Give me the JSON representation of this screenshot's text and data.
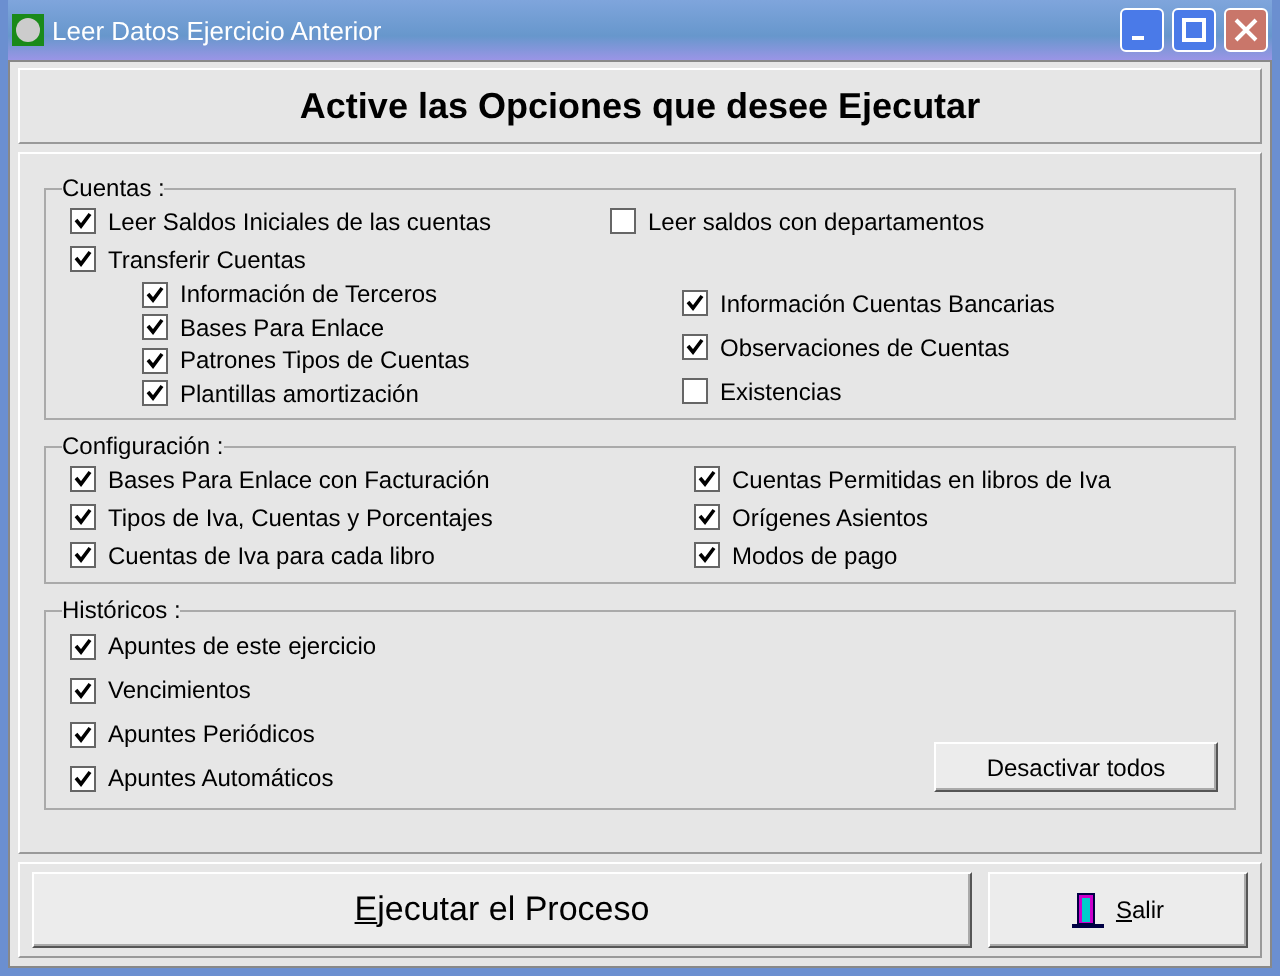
{
  "window": {
    "title": "Leer Datos Ejercicio Anterior"
  },
  "heading": "Active las Opciones que desee Ejecutar",
  "cuentas": {
    "label": "Cuentas :",
    "main": [
      {
        "label": "Leer Saldos Iniciales de las cuentas",
        "checked": true
      },
      {
        "label": "Transferir Cuentas",
        "checked": true
      }
    ],
    "side": {
      "label": "Leer saldos con departamentos",
      "checked": false
    },
    "sub_left": [
      {
        "label": "Información de Terceros",
        "checked": true
      },
      {
        "label": "Bases Para Enlace",
        "checked": true
      },
      {
        "label": "Patrones Tipos de Cuentas",
        "checked": true
      },
      {
        "label": "Plantillas amortización",
        "checked": true
      }
    ],
    "sub_right": [
      {
        "label": "Información Cuentas Bancarias",
        "checked": true
      },
      {
        "label": "Observaciones de Cuentas",
        "checked": true
      },
      {
        "label": "Existencias",
        "checked": false
      }
    ]
  },
  "configuracion": {
    "label": "Configuración :",
    "left": [
      {
        "label": "Bases Para Enlace con Facturación",
        "checked": true
      },
      {
        "label": "Tipos de Iva, Cuentas y Porcentajes",
        "checked": true
      },
      {
        "label": "Cuentas de Iva para cada libro",
        "checked": true
      }
    ],
    "right": [
      {
        "label": "Cuentas Permitidas en libros de Iva",
        "checked": true
      },
      {
        "label": "Orígenes Asientos",
        "checked": true
      },
      {
        "label": "Modos de pago",
        "checked": true
      }
    ]
  },
  "historicos": {
    "label": "Históricos :",
    "items": [
      {
        "label": "Apuntes de este ejercicio",
        "checked": true
      },
      {
        "label": "Vencimientos",
        "checked": true
      },
      {
        "label": "Apuntes Periódicos",
        "checked": true
      },
      {
        "label": "Apuntes Automáticos",
        "checked": true
      }
    ],
    "button": "Desactivar todos"
  },
  "buttons": {
    "run": "Ejecutar el Proceso",
    "exit": "Salir"
  }
}
